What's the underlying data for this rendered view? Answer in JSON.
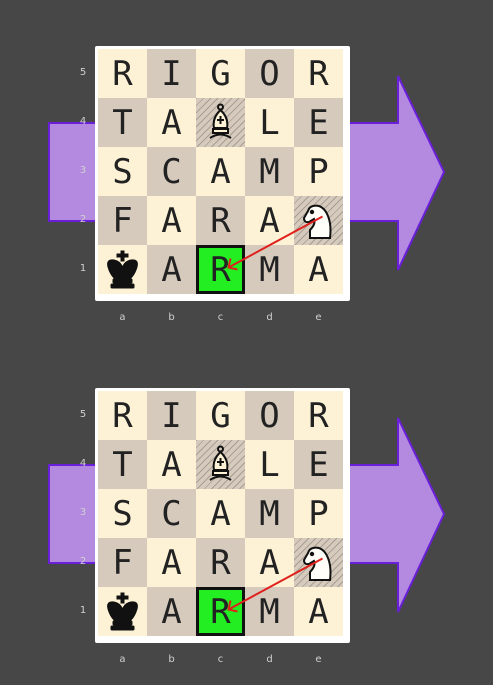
{
  "boards": [
    {
      "squares": [
        [
          "R",
          "I",
          "G",
          "O",
          "R"
        ],
        [
          "T",
          "A",
          "",
          "L",
          "E"
        ],
        [
          "S",
          "C",
          "A",
          "M",
          "P"
        ],
        [
          "F",
          "A",
          "R",
          "A",
          ""
        ],
        [
          "",
          "A",
          "R",
          "M",
          "A"
        ]
      ],
      "rank_labels": [
        "5",
        "4",
        "3",
        "2",
        "1"
      ],
      "file_labels": [
        "a",
        "b",
        "c",
        "d",
        "e"
      ],
      "pieces": [
        {
          "square": "c4",
          "type": "bishop-icon",
          "glyph": "♝",
          "hatched": true
        },
        {
          "square": "e2",
          "type": "knight-icon",
          "glyph": "♘",
          "hatched": true
        },
        {
          "square": "a1",
          "type": "king-icon",
          "glyph": "♚",
          "hatched": false
        }
      ],
      "highlight_square": "c1",
      "move": {
        "from": "e2",
        "to": "c1"
      }
    },
    {
      "squares": [
        [
          "R",
          "I",
          "G",
          "O",
          "R"
        ],
        [
          "T",
          "A",
          "",
          "L",
          "E"
        ],
        [
          "S",
          "C",
          "A",
          "M",
          "P"
        ],
        [
          "F",
          "A",
          "R",
          "A",
          ""
        ],
        [
          "",
          "A",
          "R",
          "M",
          "A"
        ]
      ],
      "rank_labels": [
        "5",
        "4",
        "3",
        "2",
        "1"
      ],
      "file_labels": [
        "a",
        "b",
        "c",
        "d",
        "e"
      ],
      "pieces": [
        {
          "square": "c4",
          "type": "bishop-icon",
          "glyph": "♝",
          "hatched": true
        },
        {
          "square": "e2",
          "type": "knight-icon",
          "glyph": "♘",
          "hatched": true
        },
        {
          "square": "a1",
          "type": "king-icon",
          "glyph": "♚",
          "hatched": false
        }
      ],
      "highlight_square": "c1",
      "move": {
        "from": "e2",
        "to": "c1"
      }
    }
  ],
  "colors": {
    "background": "#474747",
    "light_square": "#fdf2d6",
    "dark_square": "#d6cabd",
    "highlight": "#22ee22",
    "big_arrow": "#b38ae0",
    "big_arrow_border": "#6a1fd8",
    "move_arrow": "#e0201c"
  }
}
